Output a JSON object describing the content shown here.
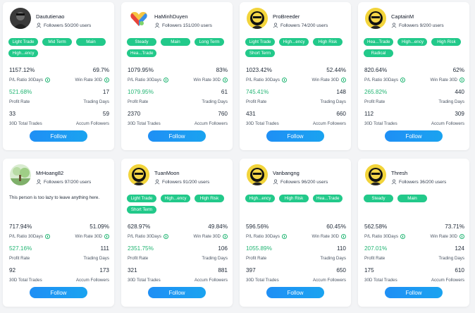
{
  "labels": {
    "pl_ratio": "P/L Ratio 30Days",
    "win_rate": "Win Rate 30D",
    "profit_rate": "Profit Rate",
    "trading_days": "Trading Days",
    "total_trades": "30D Total Trades",
    "accum_followers": "Accum Followers",
    "follow": "Follow"
  },
  "colors": {
    "tag_green": "#22c98a",
    "profit_green": "#22b573",
    "follow_blue": "#1f8ff5"
  },
  "traders": [
    {
      "name": "Daututienao",
      "followers": "Followers 50/200 users",
      "avatar_icon": "dark-portrait",
      "tags": [
        "Light Trade",
        "Mid Term",
        "Main",
        "High...ency"
      ],
      "bio": "",
      "pl_ratio": "1157.12%",
      "win_rate": "69.7%",
      "profit_rate": "521.68%",
      "trading_days": "17",
      "total_trades": "33",
      "accum_followers": "59"
    },
    {
      "name": "HaMinhDuyen",
      "followers": "Followers 151/200 users",
      "avatar_icon": "rainbow-heart",
      "tags": [
        "Steady",
        "Main",
        "Long Term",
        "Hea...Trade"
      ],
      "bio": "",
      "pl_ratio": "1079.95%",
      "win_rate": "83%",
      "profit_rate": "1079.95%",
      "trading_days": "61",
      "total_trades": "2370",
      "accum_followers": "760"
    },
    {
      "name": "ProBreeder",
      "followers": "Followers 74/200 users",
      "avatar_icon": "yellow-mascot",
      "tags": [
        "Light Trade",
        "High...ency",
        "High Risk",
        "Short Term"
      ],
      "bio": "",
      "pl_ratio": "1023.42%",
      "win_rate": "52.44%",
      "profit_rate": "745.41%",
      "trading_days": "148",
      "total_trades": "431",
      "accum_followers": "660"
    },
    {
      "name": "CaptainM",
      "followers": "Followers 9/200 users",
      "avatar_icon": "yellow-mascot",
      "tags": [
        "Hea...Trade",
        "High...ency",
        "High Risk",
        "Radical"
      ],
      "bio": "",
      "pl_ratio": "820.64%",
      "win_rate": "62%",
      "profit_rate": "265.82%",
      "trading_days": "440",
      "total_trades": "112",
      "accum_followers": "309"
    },
    {
      "name": "MrHoang82",
      "followers": "Followers 97/200 users",
      "avatar_icon": "nature-photo",
      "tags": [],
      "bio": "This person is too lazy to leave anything here.",
      "pl_ratio": "717.94%",
      "win_rate": "51.09%",
      "profit_rate": "527.16%",
      "trading_days": "111",
      "total_trades": "92",
      "accum_followers": "173"
    },
    {
      "name": "TuanMoon",
      "followers": "Followers 91/200 users",
      "avatar_icon": "yellow-mascot",
      "tags": [
        "Light Trade",
        "High...ency",
        "High Risk",
        "Short Term"
      ],
      "bio": "",
      "pl_ratio": "628.97%",
      "win_rate": "49.84%",
      "profit_rate": "2351.75%",
      "trading_days": "106",
      "total_trades": "321",
      "accum_followers": "881"
    },
    {
      "name": "Vanbangng",
      "followers": "Followers 96/200 users",
      "avatar_icon": "yellow-mascot",
      "tags": [
        "High...ency",
        "High Risk",
        "Hea...Trade"
      ],
      "bio": "",
      "pl_ratio": "596.56%",
      "win_rate": "60.45%",
      "profit_rate": "1055.89%",
      "trading_days": "110",
      "total_trades": "397",
      "accum_followers": "650"
    },
    {
      "name": "Thresh",
      "followers": "Followers 36/200 users",
      "avatar_icon": "yellow-mascot",
      "tags": [
        "Steady",
        "Main"
      ],
      "bio": "",
      "pl_ratio": "562.58%",
      "win_rate": "73.71%",
      "profit_rate": "207.01%",
      "trading_days": "124",
      "total_trades": "175",
      "accum_followers": "610"
    }
  ]
}
